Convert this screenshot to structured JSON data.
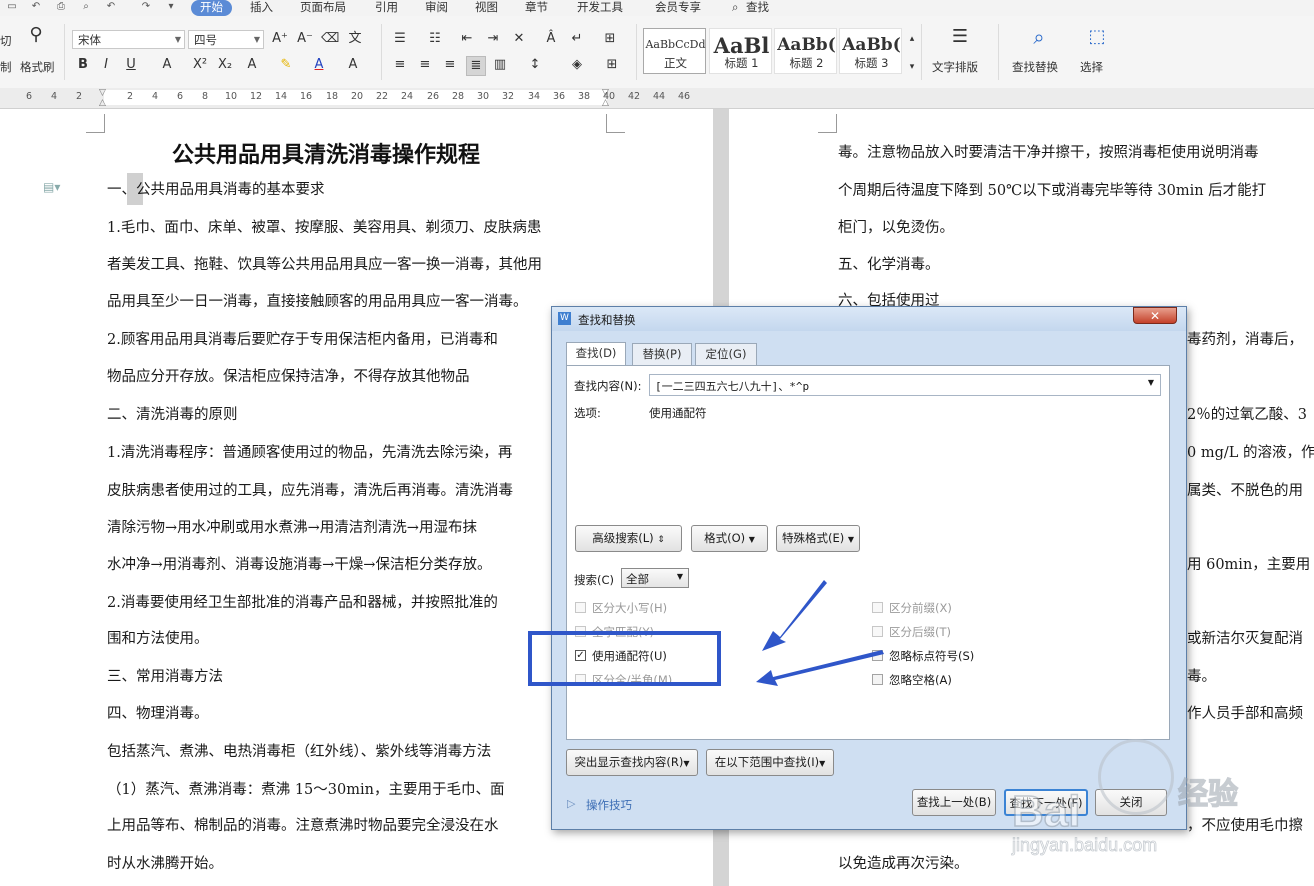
{
  "menu": {
    "tabs": [
      "开始",
      "插入",
      "页面布局",
      "引用",
      "审阅",
      "视图",
      "章节",
      "开发工具",
      "会员专享",
      "查找"
    ],
    "active": "开始"
  },
  "ribbon": {
    "clipboard_labels": [
      "切",
      "制"
    ],
    "format_painter": "格式刷",
    "font_name": "宋体",
    "font_size": "四号",
    "styles": [
      {
        "preview": "AaBbCcDd",
        "label": "正文"
      },
      {
        "preview": "AaBl",
        "label": "标题 1"
      },
      {
        "preview": "AaBb(",
        "label": "标题 2"
      },
      {
        "preview": "AaBb(",
        "label": "标题 3"
      }
    ],
    "text_layout": "文字排版",
    "find_replace": "查找替换",
    "select": "选择"
  },
  "ruler": {
    "numbers": [
      "6",
      "4",
      "2",
      "2",
      "4",
      "6",
      "8",
      "10",
      "12",
      "14",
      "16",
      "18",
      "20",
      "22",
      "24",
      "26",
      "28",
      "30",
      "32",
      "34",
      "36",
      "38",
      "40",
      "42",
      "44",
      "46"
    ]
  },
  "document": {
    "title": "公共用品用具清洗消毒操作规程",
    "left_lines": [
      "一、公共用品用具消毒的基本要求",
      "1.毛巾、面巾、床单、被罩、按摩服、美容用具、剃须刀、皮肤病患",
      "者美发工具、拖鞋、饮具等公共用品用具应一客一换一消毒，其他用",
      "品用具至少一日一消毒，直接接触顾客的用品用具应一客一消毒。",
      "2.顾客用品用具消毒后要贮存于专用保洁柜内备用，已消毒和",
      "物品应分开存放。保洁柜应保持洁净，不得存放其他物品",
      "二、清洗消毒的原则",
      "1.清洗消毒程序：普通顾客使用过的物品，先清洗去除污染，再",
      "皮肤病患者使用过的工具，应先消毒，清洗后再消毒。清洗消毒",
      "清除污物→用水冲刷或用水煮沸→用清洁剂清洗→用湿布抹",
      "水冲净→用消毒剂、消毒设施消毒→干燥→保洁柜分类存放。",
      "2.消毒要使用经卫生部批准的消毒产品和器械，并按照批准的",
      "围和方法使用。",
      "三、常用消毒方法",
      "四、物理消毒。",
      "包括蒸汽、煮沸、电热消毒柜（红外线）、紫外线等消毒方法",
      "（1）蒸汽、煮沸消毒：煮沸 15～30min，主要用于毛巾、面",
      "上用品等布、棉制品的消毒。注意煮沸时物品要完全浸没在水",
      "时从水沸腾开始。"
    ],
    "right_lines": [
      "毒。注意物品放入时要清洁干净并擦干，按照消毒柜使用说明消毒",
      "个周期后待温度下降到 50℃以下或消毒完毕等待 30min 后才能打",
      "柜门，以免烫伤。",
      "五、化学消毒。",
      "六、包括使用过",
      "毒药剂，消毒后，",
      "2％的过氧乙酸、3",
      "0 mg/L 的溶液，作",
      "属类、不脱色的用",
      "用 60min，主要用",
      "或新洁尔灭复配消",
      "毒。",
      "作人员手部和高频",
      "，不应使用毛巾擦",
      "以免造成再次污染。"
    ]
  },
  "dialog": {
    "title": "查找和替换",
    "tabs": [
      "查找(D)",
      "替换(P)",
      "定位(G)"
    ],
    "find_label": "查找内容(N):",
    "find_value": "[一二三四五六七八九十]、*^p",
    "options_label": "选项:",
    "options_value": "使用通配符",
    "advanced_btn": "高级搜索(L)",
    "format_btn": "格式(O)",
    "special_btn": "特殊格式(E)",
    "search_label": "搜索(C)",
    "search_value": "全部",
    "checkboxes_left": [
      {
        "label": "区分大小写(H)",
        "checked": false,
        "enabled": false
      },
      {
        "label": "全字匹配(Y)",
        "checked": false,
        "enabled": false
      },
      {
        "label": "使用通配符(U)",
        "checked": true,
        "enabled": true
      },
      {
        "label": "区分全/半角(M)",
        "checked": false,
        "enabled": false
      }
    ],
    "checkboxes_right": [
      {
        "label": "区分前缀(X)",
        "checked": false,
        "enabled": false
      },
      {
        "label": "区分后缀(T)",
        "checked": false,
        "enabled": false
      },
      {
        "label": "忽略标点符号(S)",
        "checked": false,
        "enabled": true
      },
      {
        "label": "忽略空格(A)",
        "checked": false,
        "enabled": true
      }
    ],
    "highlight_btn": "突出显示查找内容(R)",
    "scope_btn": "在以下范围中查找(I)",
    "tips": "操作技巧",
    "find_prev_btn": "查找上一处(B)",
    "find_next_btn": "查找下一处(F)",
    "close_btn": "关闭"
  },
  "watermark": {
    "brand": "Bai",
    "brand2": "经验",
    "url": "jingyan.baidu.com"
  },
  "colors": {
    "accent": "#5b8bd6",
    "annotation": "#2f56c9"
  }
}
